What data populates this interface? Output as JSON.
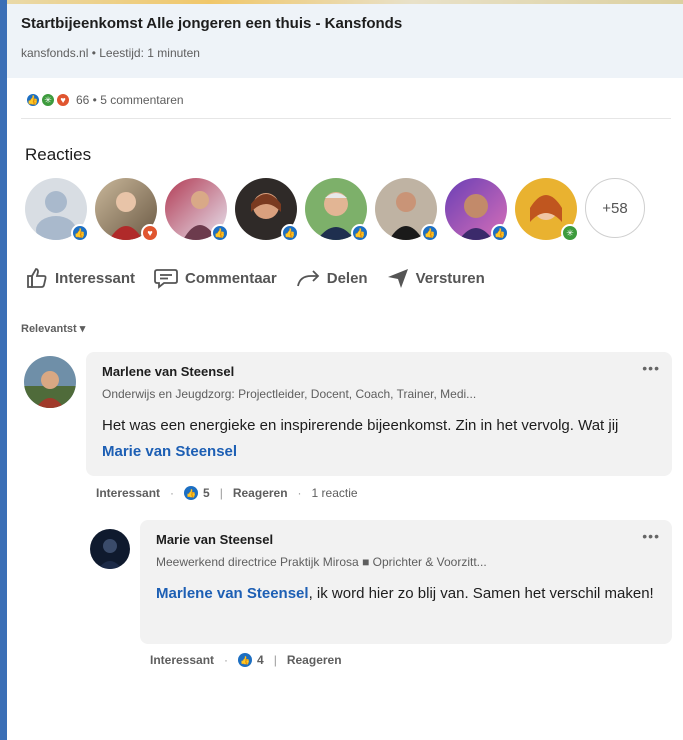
{
  "preview": {
    "title": "Startbijeenkomst Alle jongeren een thuis - Kansfonds",
    "meta": "kansfonds.nl • Leestijd: 1 minuten"
  },
  "counts": {
    "text": "66 • 5 commentaren"
  },
  "reactions_section": {
    "title": "Reacties",
    "more_label": "+58",
    "avatars": [
      {
        "badge": "like"
      },
      {
        "badge": "love"
      },
      {
        "badge": "like"
      },
      {
        "badge": "like"
      },
      {
        "badge": "like"
      },
      {
        "badge": "like"
      },
      {
        "badge": "like"
      },
      {
        "badge": "celebrate"
      }
    ]
  },
  "actions": {
    "interesting": "Interessant",
    "comment": "Commentaar",
    "share": "Delen",
    "send": "Versturen"
  },
  "sort": {
    "label": "Relevantst"
  },
  "comments": [
    {
      "name": "Marlene van Steensel",
      "headline": "Onderwijs en Jeugdzorg: Projectleider, Docent, Coach, Trainer, Medi...",
      "text_before": "Het was een energieke en inspirerende bijeenkomst. Zin in het vervolg. Wat jij ",
      "mention": "Marie van Steensel",
      "text_after": "",
      "action_like": "Interessant",
      "like_count": "5",
      "action_reply": "Reageren",
      "reply_count": "1 reactie"
    },
    {
      "name": "Marie van Steensel",
      "headline": "Meewerkend directrice Praktijk Mirosa ■ Oprichter & Voorzitt...",
      "mention": "Marlene van Steensel",
      "text_after": ", ik word hier zo blij van. Samen het verschil maken!",
      "action_like": "Interessant",
      "like_count": "4",
      "action_reply": "Reageren"
    }
  ],
  "colors": {
    "accent": "#1d6fc2",
    "love": "#e0552f",
    "celebrate": "#3d9b3d",
    "mention": "#1d5fb4"
  }
}
